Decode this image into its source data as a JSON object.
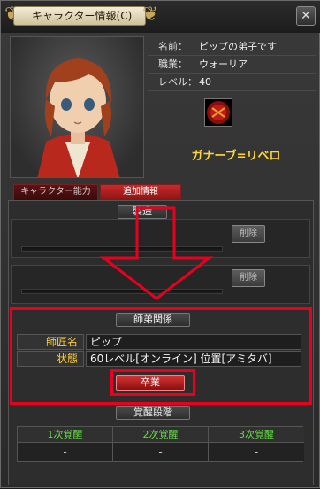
{
  "window": {
    "title": "キャラクター情報(C)",
    "close_label": "✕"
  },
  "character": {
    "name_key": "名前：",
    "name_value": "ピップの弟子です",
    "class_key": "職業：",
    "class_value": "ウォーリア",
    "level_key": "レベル：",
    "level_value": "40",
    "guild_name": "ガナーブ=リベロ"
  },
  "tabs": {
    "ability": "キャラクター能力",
    "extra": "追加情報"
  },
  "craft": {
    "header": "製造",
    "slot1_button": "削除",
    "slot2_button": "削除"
  },
  "mentor": {
    "header": "師弟関係",
    "master_key": "師匠名",
    "master_value": "ピップ",
    "status_key": "状態",
    "status_value": "60レベル[オンライン] 位置[アミタバ]",
    "graduate_button": "卒業"
  },
  "awakening": {
    "header": "覚醒段階",
    "columns": [
      {
        "label": "1次覚醒",
        "value": "-"
      },
      {
        "label": "2次覚醒",
        "value": "-"
      },
      {
        "label": "3次覚醒",
        "value": "-"
      }
    ]
  },
  "colors": {
    "highlight": "#e8001e",
    "guild": "#ffd838",
    "awake_label": "#66dd44"
  }
}
